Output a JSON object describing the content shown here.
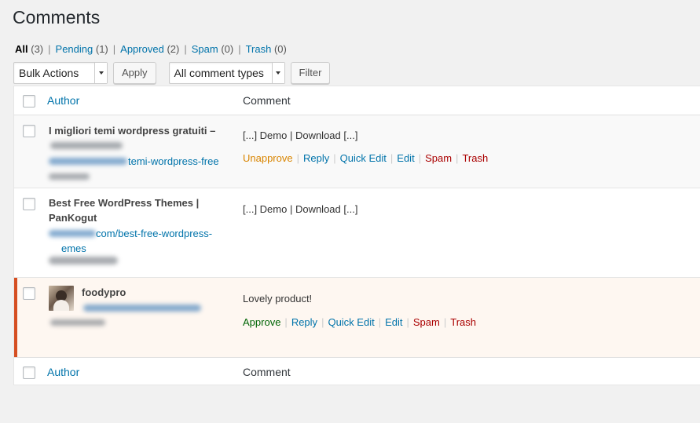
{
  "page": {
    "title": "Comments"
  },
  "filters": [
    {
      "label": "All",
      "count": "(3)"
    },
    {
      "label": "Pending",
      "count": "(1)"
    },
    {
      "label": "Approved",
      "count": "(2)"
    },
    {
      "label": "Spam",
      "count": "(0)"
    },
    {
      "label": "Trash",
      "count": "(0)"
    }
  ],
  "tablenav": {
    "bulk_actions": "Bulk Actions",
    "apply": "Apply",
    "comment_types": "All comment types",
    "filter": "Filter"
  },
  "table": {
    "col_author": "Author",
    "col_comment": "Comment",
    "rows": [
      {
        "author_name": "I migliori temi wordpress gratuiti –",
        "author_url": "temi-wordpress-free",
        "comment": "[...] Demo | Download [...]",
        "actions": [
          "Unapprove",
          "Reply",
          "Quick Edit",
          "Edit",
          "Spam",
          "Trash"
        ]
      },
      {
        "author_name_line1": "Best Free WordPress Themes |",
        "author_name_line2": "PanKogut",
        "author_url_line1": "com/best-free-wordpress-",
        "author_url_line2": "emes",
        "comment": "[...] Demo | Download [...]"
      },
      {
        "author_name": "foodypro",
        "comment": "Lovely product!",
        "actions": [
          "Approve",
          "Reply",
          "Quick Edit",
          "Edit",
          "Spam",
          "Trash"
        ]
      }
    ]
  },
  "colors": {
    "link": "#0073aa",
    "unapprove": "#d98500",
    "approve": "#006505",
    "danger": "#a00",
    "pending_border": "#d54e21",
    "pending_bg": "#fef7f1"
  }
}
